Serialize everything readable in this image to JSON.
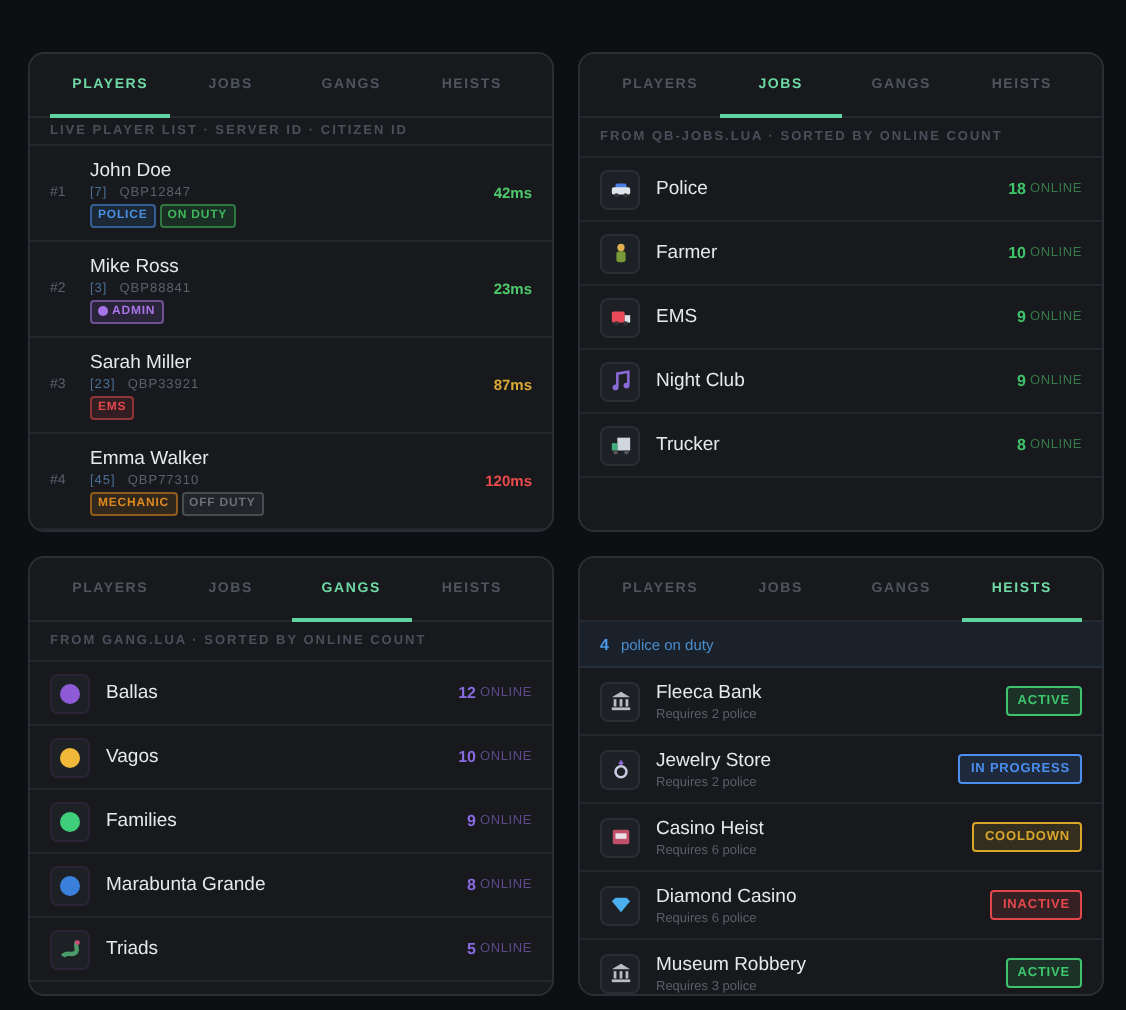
{
  "panels": [
    {
      "kind": "players",
      "tabs": [
        {
          "label": "PLAYERS",
          "selected": true
        },
        {
          "label": "JOBS",
          "selected": false
        },
        {
          "label": "GANGS",
          "selected": false
        },
        {
          "label": "HEISTS",
          "selected": false
        }
      ],
      "header": "LIVE PLAYER LIST · SERVER ID · CITIZEN ID",
      "players": [
        {
          "rank": "#1",
          "name": "John Doe",
          "server_id": "[7]",
          "citizen_id": "QBP12847",
          "ping": "42ms",
          "color": "#4ec96a",
          "tags": [
            {
              "label": "POLICE",
              "color": "#4a90e2",
              "kind": "plain"
            },
            {
              "label": "ON DUTY",
              "color": "#3fb85c",
              "kind": "plain"
            }
          ]
        },
        {
          "rank": "#2",
          "name": "Mike Ross",
          "server_id": "[3]",
          "citizen_id": "QBP88841",
          "ping": "23ms",
          "color": "#4ec96a",
          "tags": [
            {
              "label": "ADMIN",
              "color": "#a874e8",
              "kind": "dot"
            }
          ]
        },
        {
          "rank": "#3",
          "name": "Sarah Miller",
          "server_id": "[23]",
          "citizen_id": "QBP33921",
          "ping": "87ms",
          "color": "#d9a934",
          "tags": [
            {
              "label": "EMS",
              "color": "#e0474c",
              "kind": "plain"
            }
          ]
        },
        {
          "rank": "#4",
          "name": "Emma Walker",
          "server_id": "[45]",
          "citizen_id": "QBP77310",
          "ping": "120ms",
          "color": "#ec4b4b",
          "tags": [
            {
              "label": "MECHANIC",
              "color": "#e08a1e",
              "kind": "plain"
            },
            {
              "label": "OFF DUTY",
              "color": "#6b7078",
              "kind": "plain"
            }
          ]
        }
      ]
    },
    {
      "kind": "jobs",
      "tabs": [
        {
          "label": "PLAYERS",
          "selected": false
        },
        {
          "label": "JOBS",
          "selected": true
        },
        {
          "label": "GANGS",
          "selected": false
        },
        {
          "label": "HEISTS",
          "selected": false
        }
      ],
      "header": "FROM QB-JOBS.LUA · SORTED BY ONLINE COUNT",
      "items": [
        {
          "kind": "car",
          "name": "Police",
          "count": "18",
          "unit": "ONLINE"
        },
        {
          "kind": "farmer",
          "name": "Farmer",
          "count": "10",
          "unit": "ONLINE"
        },
        {
          "kind": "ambulance",
          "name": "EMS",
          "count": "9",
          "unit": "ONLINE"
        },
        {
          "kind": "music",
          "name": "Night Club",
          "count": "9",
          "unit": "ONLINE"
        },
        {
          "kind": "truck",
          "name": "Trucker",
          "count": "8",
          "unit": "ONLINE"
        }
      ]
    },
    {
      "kind": "gangs",
      "tabs": [
        {
          "label": "PLAYERS",
          "selected": false
        },
        {
          "label": "JOBS",
          "selected": false
        },
        {
          "label": "GANGS",
          "selected": true
        },
        {
          "label": "HEISTS",
          "selected": false
        }
      ],
      "header": "FROM GANG.LUA · SORTED BY ONLINE COUNT",
      "items": [
        {
          "kind": "dot",
          "color": "#8e5ad6",
          "name": "Ballas",
          "count": "12",
          "unit": "ONLINE"
        },
        {
          "kind": "dot",
          "color": "#f0b93a",
          "name": "Vagos",
          "count": "10",
          "unit": "ONLINE"
        },
        {
          "kind": "dot",
          "color": "#3fcf7a",
          "name": "Families",
          "count": "9",
          "unit": "ONLINE"
        },
        {
          "kind": "dot",
          "color": "#3a7fd9",
          "name": "Marabunta Grande",
          "count": "8",
          "unit": "ONLINE"
        },
        {
          "kind": "dragon",
          "color": "#4a9a6a",
          "name": "Triads",
          "count": "5",
          "unit": "ONLINE"
        }
      ]
    },
    {
      "kind": "heists",
      "tabs": [
        {
          "label": "PLAYERS",
          "selected": false
        },
        {
          "label": "JOBS",
          "selected": false
        },
        {
          "label": "GANGS",
          "selected": false
        },
        {
          "label": "HEISTS",
          "selected": true
        }
      ],
      "police_count": "4",
      "police_text": "police on duty",
      "heists": [
        {
          "kind": "bank",
          "name": "Fleeca Bank",
          "requirement": "Requires 2 police",
          "color": "#3fc46a",
          "status_label": "ACTIVE"
        },
        {
          "kind": "ring",
          "name": "Jewelry Store",
          "requirement": "Requires 2 police",
          "color": "#4a8ff0",
          "status_label": "IN PROGRESS"
        },
        {
          "kind": "slot",
          "name": "Casino Heist",
          "requirement": "Requires 6 police",
          "color": "#d9a52a",
          "status_label": "COOLDOWN"
        },
        {
          "kind": "gem",
          "name": "Diamond Casino",
          "requirement": "Requires 6 police",
          "color": "#e2474b",
          "status_label": "INACTIVE"
        },
        {
          "kind": "bank",
          "name": "Museum Robbery",
          "requirement": "Requires 3 police",
          "color": "#3fc46a",
          "status_label": "ACTIVE"
        }
      ]
    }
  ]
}
